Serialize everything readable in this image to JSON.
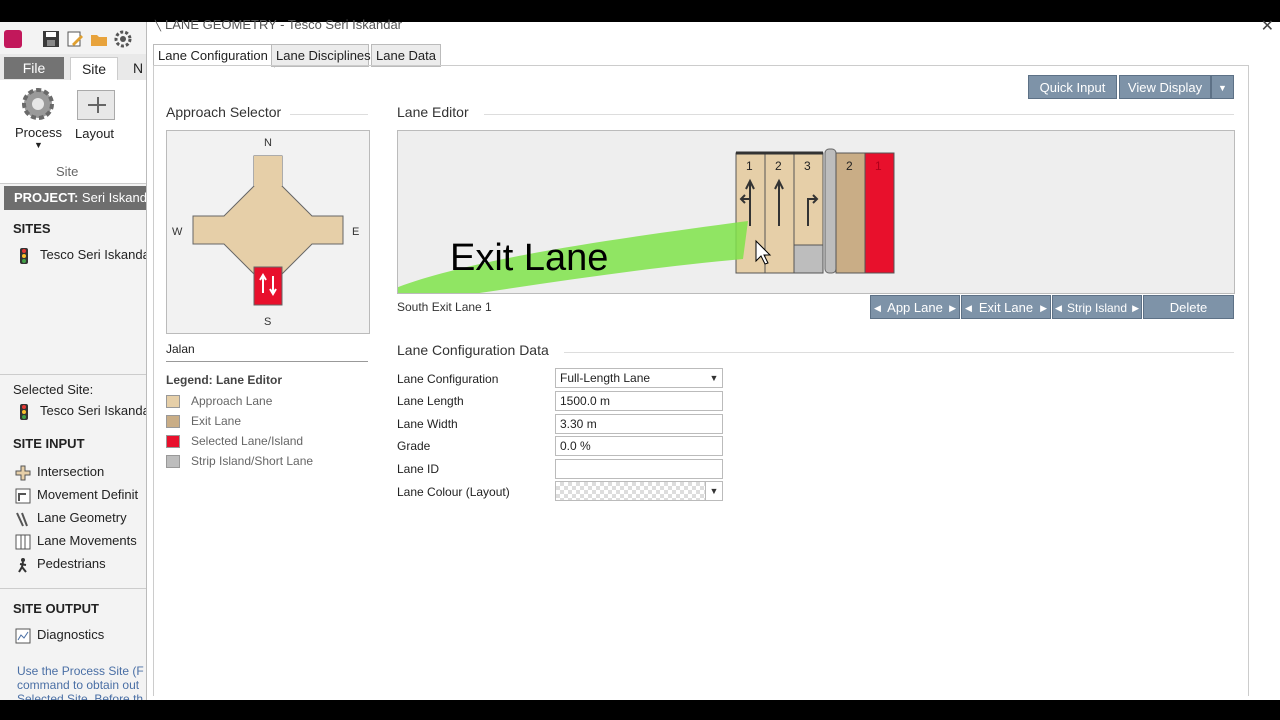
{
  "app": {
    "ribbon_tabs": {
      "file": "File",
      "site": "Site",
      "next": "N"
    },
    "ribbon": {
      "process_label": "Process",
      "layout_label": "Layout",
      "group_label": "Site"
    },
    "project_label": "PROJECT:",
    "project_name": "Seri Iskanda",
    "sites_heading": "SITES",
    "site_name": "Tesco Seri Iskanda",
    "selected_site_label": "Selected Site:",
    "selected_site_name": "Tesco Seri Iskanda",
    "site_input_heading": "SITE INPUT",
    "site_input_items": [
      "Intersection",
      "Movement Definit",
      "Lane Geometry",
      "Lane Movements",
      "Pedestrians"
    ],
    "site_output_heading": "SITE OUTPUT",
    "site_output_items": [
      "Diagnostics"
    ],
    "help_text": [
      "Use the Process Site (F",
      "command to obtain out",
      "Selected Site. Before th"
    ]
  },
  "dialog": {
    "title": "LANE GEOMETRY - Tesco Seri Iskandar",
    "tabs": [
      "Lane Configuration",
      "Lane Disciplines",
      "Lane Data"
    ],
    "buttons": {
      "quick_input": "Quick Input",
      "view_display": "View Display"
    },
    "approach_selector": {
      "title": "Approach Selector",
      "compass": {
        "n": "N",
        "s": "S",
        "e": "E",
        "w": "W"
      },
      "approach_name": "Jalan"
    },
    "legend": {
      "title": "Legend: Lane Editor",
      "items": [
        {
          "label": "Approach Lane",
          "color": "#e6cfa8"
        },
        {
          "label": "Exit Lane",
          "color": "#c9ad86"
        },
        {
          "label": "Selected Lane/Island",
          "color": "#e8102c"
        },
        {
          "label": "Strip Island/Short Lane",
          "color": "#bdbdbd"
        }
      ]
    },
    "lane_editor": {
      "title": "Lane Editor",
      "approach_lane_numbers": [
        "1",
        "2",
        "3"
      ],
      "exit_lane_numbers": [
        "2",
        "1"
      ],
      "selected_lane_caption": "South Exit Lane 1",
      "overlay_text": "Exit Lane",
      "buttons": {
        "app_lane": "App Lane",
        "exit_lane": "Exit Lane",
        "strip_island": "Strip Island",
        "delete": "Delete"
      }
    },
    "config_data": {
      "title": "Lane Configuration Data",
      "fields": [
        {
          "label": "Lane Configuration",
          "value": "Full-Length Lane"
        },
        {
          "label": "Lane Length",
          "value": "1500.0 m"
        },
        {
          "label": "Lane Width",
          "value": "3.30 m"
        },
        {
          "label": "Grade",
          "value": "0.0 %"
        },
        {
          "label": "Lane ID",
          "value": ""
        },
        {
          "label": "Lane Colour (Layout)",
          "value": ""
        }
      ]
    }
  }
}
